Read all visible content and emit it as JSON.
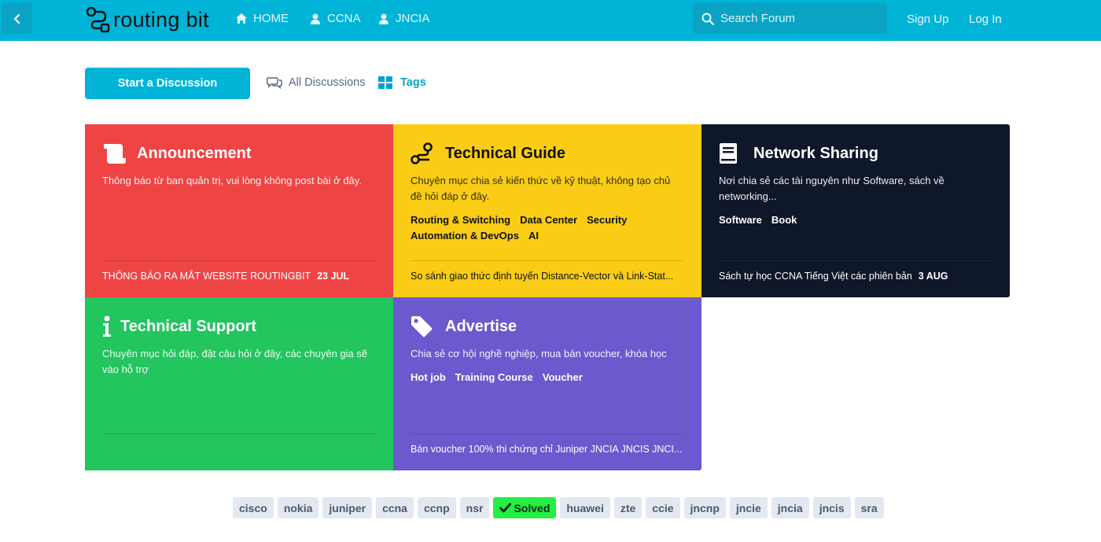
{
  "header": {
    "logo_text": "routing bit",
    "nav": [
      {
        "label": "HOME",
        "icon": "home-icon"
      },
      {
        "label": "CCNA",
        "icon": "user-icon"
      },
      {
        "label": "JNCIA",
        "icon": "user-icon"
      }
    ],
    "search_placeholder": "Search Forum",
    "signup": "Sign Up",
    "login": "Log In",
    "colors": {
      "bar": "#00b4d8",
      "field": "#0aa3c4"
    }
  },
  "toolbar": {
    "start": "Start a Discussion",
    "all_discussions": "All Discussions",
    "tags": "Tags"
  },
  "tiles": [
    {
      "title": "Announcement",
      "icon": "scroll-icon",
      "color": "#ef4444",
      "description": "Thông báo từ ban quản trị, vui lòng không post bài ở đây.",
      "tags": [],
      "last_post": "THÔNG BÁO RA MẮT WEBSITE ROUTINGBIT",
      "last_date": "23 JUL"
    },
    {
      "title": "Technical Guide",
      "icon": "route-icon",
      "color": "#facc15",
      "description": "Chuyên mục chia sẻ kiến thức về kỹ thuật, không tạo chủ đề hỏi đáp ở đây.",
      "tags": [
        "Routing & Switching",
        "Data Center",
        "Security",
        "Automation & DevOps",
        "AI"
      ],
      "last_post": "So sánh giao thức định tuyến Distance-Vector và Link-Stat...",
      "last_date": ""
    },
    {
      "title": "Network Sharing",
      "icon": "book-icon",
      "color": "#0f172a",
      "description": "Nơi chia sẻ các tài nguyên như Software, sách về networking...",
      "tags": [
        "Software",
        "Book"
      ],
      "last_post": "Sách tự học CCNA Tiếng Việt các phiên bản",
      "last_date": "3 AUG"
    },
    {
      "title": "Technical Support",
      "icon": "info-icon",
      "color": "#22c55e",
      "description": "Chuyên mục hỏi đáp, đặt câu hỏi ở đây, các chuyên gia sẽ vào hỗ trợ",
      "tags": [],
      "last_post": "",
      "last_date": ""
    },
    {
      "title": "Advertise",
      "icon": "tag-icon",
      "color": "#6a5acd",
      "description": "Chia sẻ cơ hội nghề nghiệp, mua bán voucher, khóa học",
      "tags": [
        "Hot job",
        "Training Course",
        "Voucher"
      ],
      "last_post": "Bán voucher 100% thi chứng chỉ Juniper JNCIA JNCIS JNCI...",
      "last_date": ""
    }
  ],
  "tag_cloud": [
    "cisco",
    "nokia",
    "juniper",
    "ccna",
    "ccnp",
    "nsr",
    "Solved",
    "huawei",
    "zte",
    "ccie",
    "jncnp",
    "jncie",
    "jncia",
    "jncis",
    "sra"
  ]
}
